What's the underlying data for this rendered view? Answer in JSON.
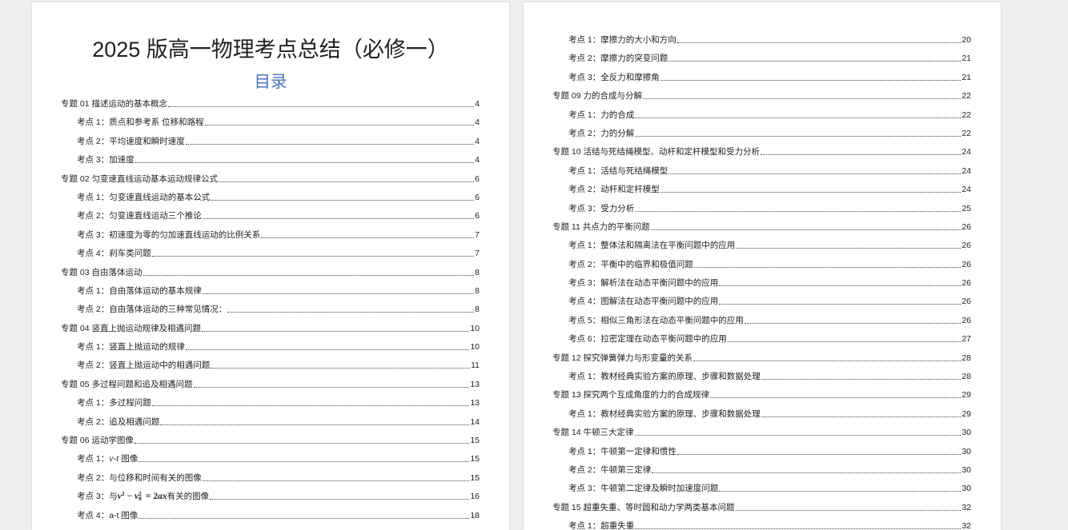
{
  "colors": {
    "viewer_background": "#eeeeee",
    "page_background": "#ffffff",
    "text": "#1f1f1f",
    "toc_heading": "#4a72be",
    "leader": "#444444"
  },
  "pages": [
    {
      "title": "2025 版高一物理考点总结（必修一）",
      "toc_heading": "目录",
      "sections": [
        {
          "label": "专题 01 描述运动的基本概念",
          "page": "4",
          "items": [
            {
              "label": "考点 1：质点和参考系 位移和路程",
              "page": "4"
            },
            {
              "label": "考点 2：平均速度和瞬时速度",
              "page": "4"
            },
            {
              "label": "考点 3：加速度",
              "page": "4"
            }
          ]
        },
        {
          "label": "专题 02 匀变速直线运动基本运动规律公式",
          "page": "6",
          "items": [
            {
              "label": "考点 1：匀变速直线运动的基本公式",
              "page": "6"
            },
            {
              "label": "考点 2：匀变速直线运动三个推论",
              "page": "6"
            },
            {
              "label": "考点 3：初速度为零的匀加速直线运动的比例关系",
              "page": "7"
            },
            {
              "label": "考点 4：刹车类问题",
              "page": "7"
            }
          ]
        },
        {
          "label": "专题 03 自由落体运动",
          "page": "8",
          "items": [
            {
              "label": "考点 1：自由落体运动的基本规律",
              "page": "8"
            },
            {
              "label": "考点 2：自由落体运动的三种常见情况：",
              "page": "8"
            }
          ]
        },
        {
          "label": "专题 04 竖直上抛运动规律及相遇问题",
          "page": "10",
          "items": [
            {
              "label": "考点 1：竖直上抛运动的规律",
              "page": "10"
            },
            {
              "label": "考点 2：竖直上抛运动中的相遇问题",
              "page": "11"
            }
          ]
        },
        {
          "label": "专题 05 多过程问题和追及相遇问题",
          "page": "13",
          "items": [
            {
              "label": "考点 1：多过程问题",
              "page": "13"
            },
            {
              "label": "考点 2：追及相遇问题",
              "page": "14"
            }
          ]
        },
        {
          "label": "专题 06 运动学图像",
          "page": "15",
          "items": [
            {
              "parts": [
                {
                  "text": "考点 1："
                },
                {
                  "imath": "v-t"
                },
                {
                  "text": " 图像"
                }
              ],
              "page": "15"
            },
            {
              "label": "考点 2：与位移和时间有关的图像",
              "page": "15"
            },
            {
              "parts": [
                {
                  "text": "考点 3：与"
                },
                {
                  "math": "v"
                },
                {
                  "sup": "2"
                },
                {
                  "op": " − "
                },
                {
                  "math": "v"
                },
                {
                  "sub_sup": {
                    "sub": "0",
                    "sup": "2"
                  }
                },
                {
                  "op": " = "
                },
                {
                  "bold": "2"
                },
                {
                  "math": "ax"
                },
                {
                  "text": "有关的图像"
                }
              ],
              "page": "16"
            },
            {
              "label": "考点 4：a-t 图像",
              "page": "18"
            }
          ]
        }
      ]
    },
    {
      "sections": [
        {
          "items": [
            {
              "label": "考点 1：摩擦力的大小和方向",
              "page": "20"
            },
            {
              "label": "考点 2：摩擦力的突变问题",
              "page": "21"
            },
            {
              "label": "考点 3：全反力和摩擦角",
              "page": "21"
            }
          ]
        },
        {
          "label": "专题 09 力的合成与分解",
          "page": "22",
          "items": [
            {
              "label": "考点 1：力的合成",
              "page": "22"
            },
            {
              "label": "考点 2：力的分解",
              "page": "22"
            }
          ]
        },
        {
          "label": "专题 10 活结与死结绳模型、动杆和定杆模型和受力分析",
          "page": "24",
          "items": [
            {
              "label": "考点 1：活结与死结绳模型",
              "page": "24"
            },
            {
              "label": "考点 2：动杆和定杆模型",
              "page": "24"
            },
            {
              "label": "考点 3：受力分析",
              "page": "25"
            }
          ]
        },
        {
          "label": "专题 11 共点力的平衡问题",
          "page": "26",
          "items": [
            {
              "label": "考点 1：整体法和隔离法在平衡问题中的应用",
              "page": "26"
            },
            {
              "label": "考点 2：平衡中的临界和极值问题",
              "page": "26"
            },
            {
              "label": "考点 3：解析法在动态平衡问题中的应用",
              "page": "26"
            },
            {
              "label": "考点 4：图解法在动态平衡问题中的应用",
              "page": "26"
            },
            {
              "label": "考点 5：相似三角形法在动态平衡问题中的应用",
              "page": "26"
            },
            {
              "label": "考点 6：拉密定理在动态平衡问题中的应用",
              "page": "27"
            }
          ]
        },
        {
          "label": "专题 12 探究弹簧弹力与形变量的关系",
          "page": "28",
          "items": [
            {
              "label": "考点 1：教材经典实验方案的原理、步骤和数据处理",
              "page": "28"
            }
          ]
        },
        {
          "label": "专题 13 探究两个互成角度的力的合成规律",
          "page": "29",
          "items": [
            {
              "label": "考点 1：教材经典实验方案的原理、步骤和数据处理",
              "page": "29"
            }
          ]
        },
        {
          "label": "专题 14 牛顿三大定律",
          "page": "30",
          "items": [
            {
              "label": "考点 1：牛顿第一定律和惯性",
              "page": "30"
            },
            {
              "label": "考点 2：牛顿第三定律",
              "page": "30"
            },
            {
              "label": "考点 3：牛顿第二定律及瞬时加速度问题",
              "page": "30"
            }
          ]
        },
        {
          "label": "专题 15 超重失重、等时圆和动力学两类基本问题",
          "page": "32",
          "items": [
            {
              "label": "考点 1：超重失重",
              "page": "32"
            }
          ]
        }
      ]
    }
  ]
}
